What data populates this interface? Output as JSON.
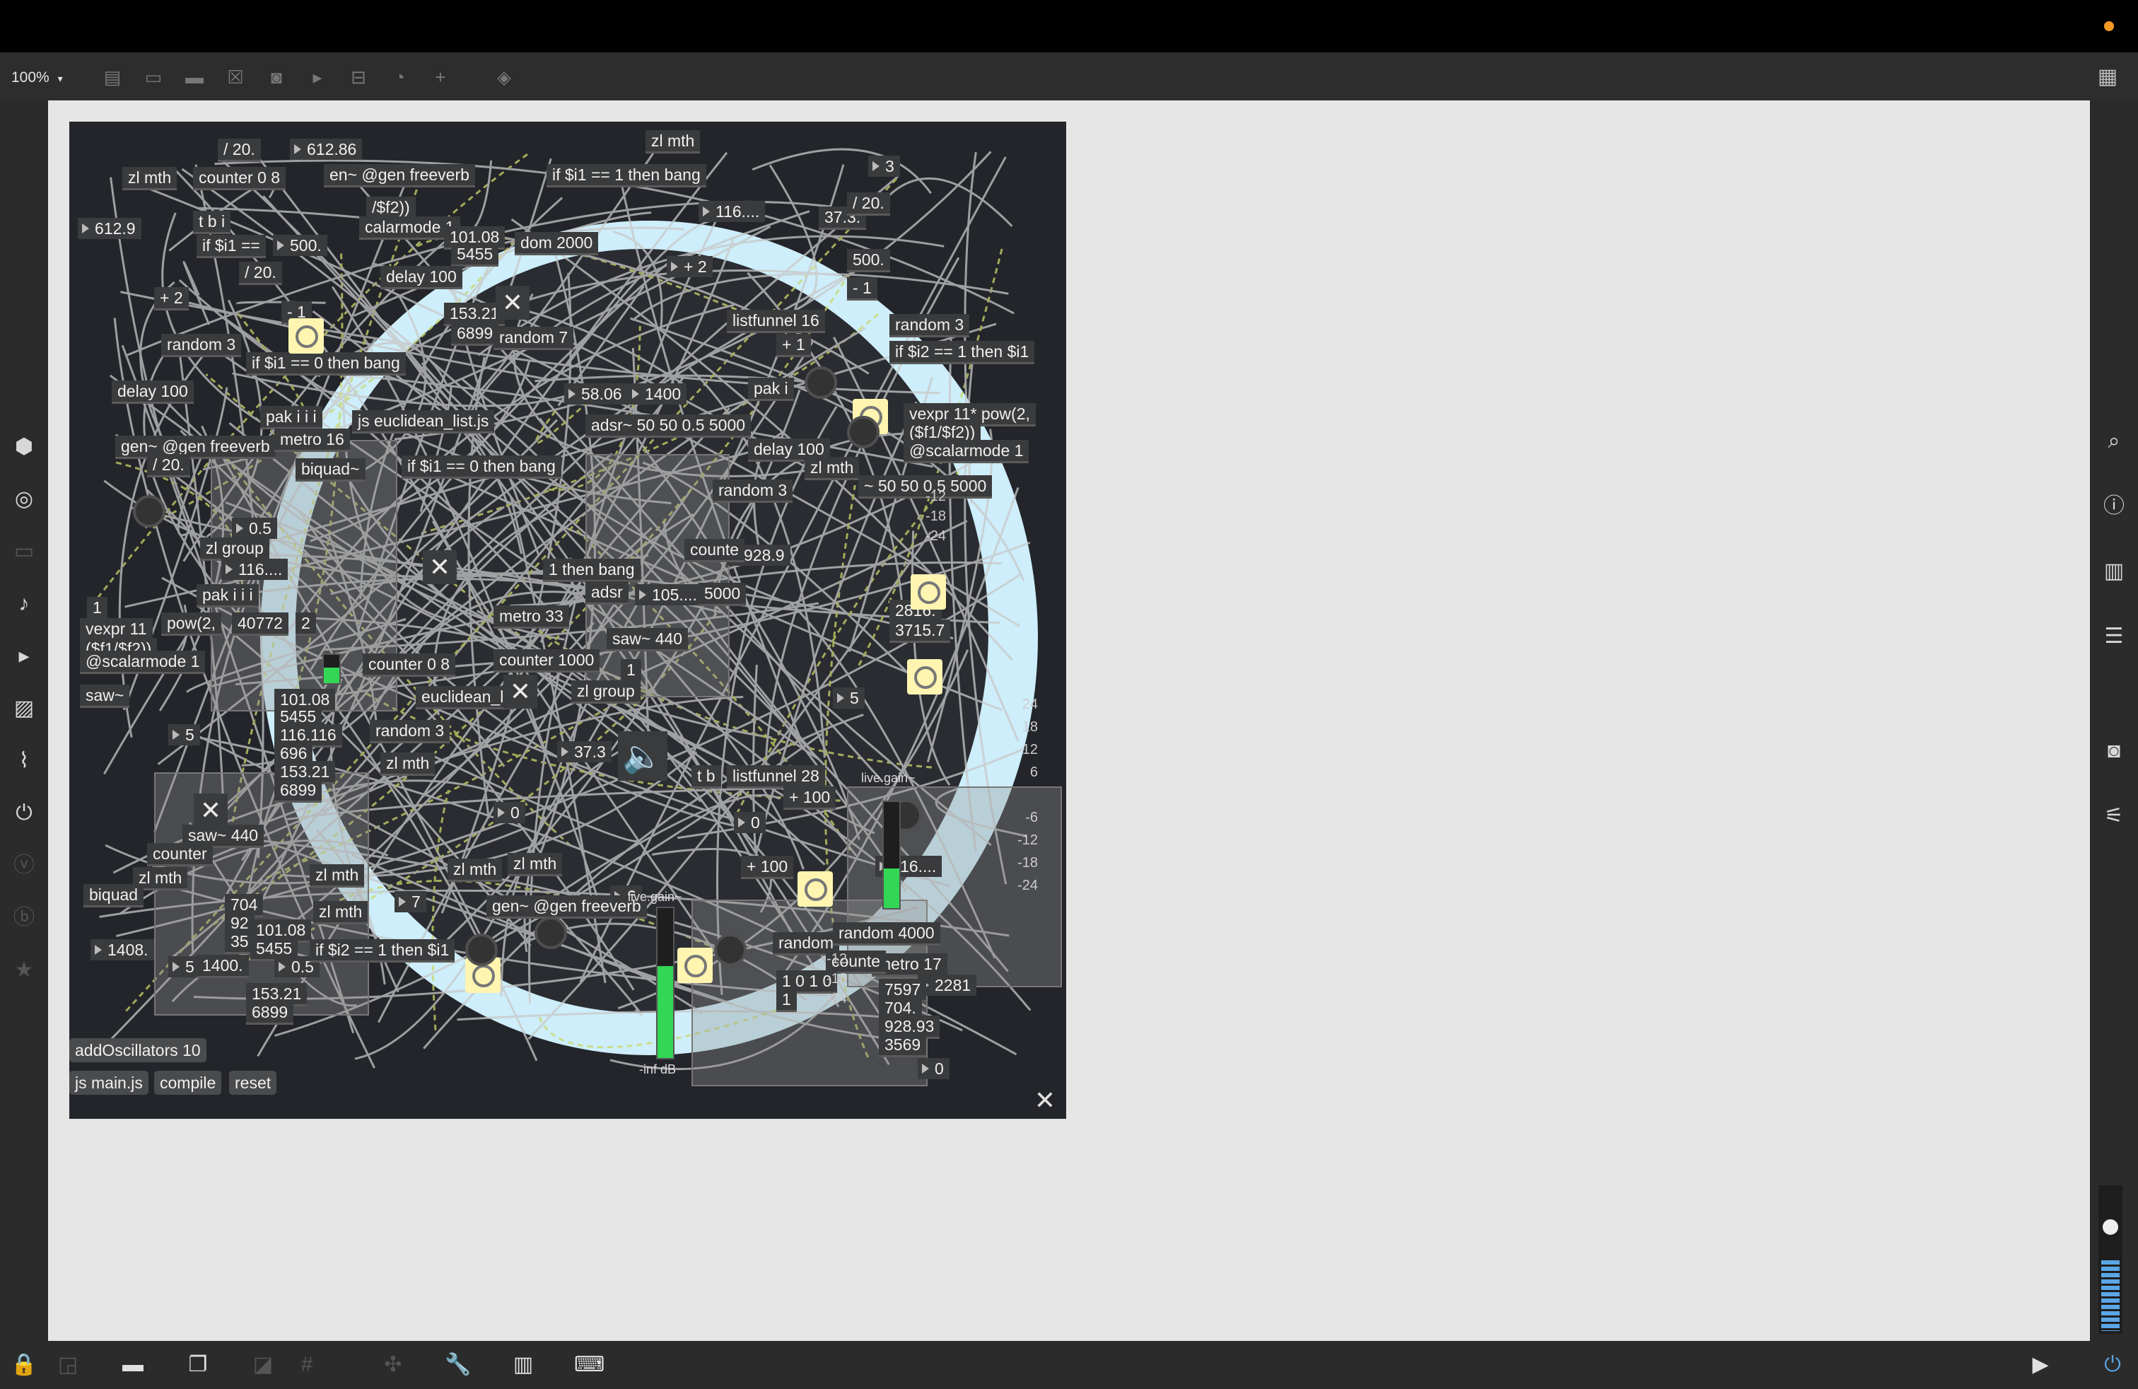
{
  "toolbar": {
    "zoom_label": "100%",
    "zoom_caret": "▾",
    "icons": [
      "presentation-icon",
      "object-icon",
      "message-icon",
      "toggle-box-icon",
      "button-box-icon",
      "number-box-icon",
      "slider-box-icon",
      "dial-icon",
      "add-icon",
      "paint-bucket-icon"
    ],
    "grid_icon": "▦"
  },
  "left_sidebar": {
    "icons": [
      "package-icon",
      "target-icon",
      "device-icon",
      "music-note-icon",
      "clip-icon",
      "image-icon",
      "attach-icon",
      "plug-icon",
      "vimeo-icon",
      "history-icon",
      "favorite-icon"
    ]
  },
  "right_sidebar": {
    "icons": [
      "search-icon",
      "info-icon",
      "split-view-icon",
      "list-icon",
      "snapshot-icon",
      "mixer-icon"
    ]
  },
  "patch": {
    "objects": [
      {
        "t": "/ 20."
      },
      {
        "t": "612.86"
      },
      {
        "t": "zl mth"
      },
      {
        "t": "counter 0 8"
      },
      {
        "t": "en~ @gen freeverb"
      },
      {
        "t": "if $i1 == 1 then bang"
      },
      {
        "t": "zl mth"
      },
      {
        "t": "3"
      },
      {
        "t": "612.9"
      },
      {
        "t": "t b i"
      },
      {
        "t": "/$f2))"
      },
      {
        "t": "calarmode 1"
      },
      {
        "t": "116...."
      },
      {
        "t": "37.3."
      },
      {
        "t": "/ 20."
      },
      {
        "t": "if $i1 =="
      },
      {
        "t": "500."
      },
      {
        "t": "101.08"
      },
      {
        "t": "5455"
      },
      {
        "t": "dom 2000"
      },
      {
        "t": "+ 2"
      },
      {
        "t": "500."
      },
      {
        "t": "/ 20."
      },
      {
        "t": "delay 100"
      },
      {
        "t": "- 1"
      },
      {
        "t": "+ 2"
      },
      {
        "t": "- 1"
      },
      {
        "t": "153.21"
      },
      {
        "t": "6899"
      },
      {
        "t": "listfunnel 16"
      },
      {
        "t": "random 3"
      },
      {
        "t": "random 3"
      },
      {
        "t": "random 7"
      },
      {
        "t": "+ 1"
      },
      {
        "t": "if $i2 == 1 then $i1"
      },
      {
        "t": "if $i1 == 0 then bang"
      },
      {
        "t": "delay 100"
      },
      {
        "t": "58.06"
      },
      {
        "t": "1400"
      },
      {
        "t": "pak i"
      },
      {
        "t": "vexpr 11* pow(2,"
      },
      {
        "t": "($f1/$f2))"
      },
      {
        "t": "@scalarmode 1"
      },
      {
        "t": "pak i i i"
      },
      {
        "t": "js euclidean_list.js"
      },
      {
        "t": "adsr~ 50 50 0.5 5000"
      },
      {
        "t": "gen~ @gen freeverb"
      },
      {
        "t": "metro 16"
      },
      {
        "t": "delay 100"
      },
      {
        "t": "zl mth"
      },
      {
        "t": "/ 20."
      },
      {
        "t": "biquad~"
      },
      {
        "t": "if $i1 == 0 then bang"
      },
      {
        "t": "random 3"
      },
      {
        "t": "~ 50 50 0.5 5000"
      },
      {
        "t": "0.5"
      },
      {
        "t": "zl group"
      },
      {
        "t": "116...."
      },
      {
        "t": "928.9"
      },
      {
        "t": "counte"
      },
      {
        "t": "pak i i i"
      },
      {
        "t": "1 then bang"
      },
      {
        "t": "adsr"
      },
      {
        "t": "105...."
      },
      {
        "t": "5000"
      },
      {
        "t": "1"
      },
      {
        "t": "pow(2,"
      },
      {
        "t": "40772"
      },
      {
        "t": "2"
      },
      {
        "t": "metro 33"
      },
      {
        "t": "2816."
      },
      {
        "t": "3715.7"
      },
      {
        "t": "vexpr 11"
      },
      {
        "t": "($f1/$f2))"
      },
      {
        "t": "@scalarmode 1"
      },
      {
        "t": "saw~ 440"
      },
      {
        "t": "counter 0 8"
      },
      {
        "t": "counter 1000"
      },
      {
        "t": "1"
      },
      {
        "t": "saw~"
      },
      {
        "t": "101.08"
      },
      {
        "t": "5455"
      },
      {
        "t": "116.116"
      },
      {
        "t": "696"
      },
      {
        "t": "153.21"
      },
      {
        "t": "6899"
      },
      {
        "t": "euclidean_li"
      },
      {
        "t": "zl group"
      },
      {
        "t": "5"
      },
      {
        "t": "5"
      },
      {
        "t": "random 3"
      },
      {
        "t": "zl mth"
      },
      {
        "t": "37.3"
      },
      {
        "t": "t b"
      },
      {
        "t": "listfunnel 28"
      },
      {
        "t": "+ 100"
      },
      {
        "t": "saw~ 440"
      },
      {
        "t": "0"
      },
      {
        "t": "0"
      },
      {
        "t": "counter"
      },
      {
        "t": "zl mth"
      },
      {
        "t": "zl mth"
      },
      {
        "t": "zl mth"
      },
      {
        "t": "zl mth"
      },
      {
        "t": "+ 100"
      },
      {
        "t": "116...."
      },
      {
        "t": "biquad"
      },
      {
        "t": "704"
      },
      {
        "t": "92"
      },
      {
        "t": "35"
      },
      {
        "t": "zl mth"
      },
      {
        "t": "7"
      },
      {
        "t": "6"
      },
      {
        "t": "gen~ @gen freeverb"
      },
      {
        "t": "random"
      },
      {
        "t": "random 4000"
      },
      {
        "t": "1408."
      },
      {
        "t": "5"
      },
      {
        "t": "1400."
      },
      {
        "t": "101.08"
      },
      {
        "t": "5455"
      },
      {
        "t": "0.5"
      },
      {
        "t": "if $i2 == 1 then $i1"
      },
      {
        "t": "metro 17"
      },
      {
        "t": "2281"
      },
      {
        "t": "counte"
      },
      {
        "t": "7597"
      },
      {
        "t": "704."
      },
      {
        "t": "928.93"
      },
      {
        "t": "3569"
      },
      {
        "t": "153.21"
      },
      {
        "t": "6899"
      },
      {
        "t": "1 0 1 0"
      },
      {
        "t": "1"
      },
      {
        "t": "0"
      }
    ],
    "messages": {
      "add_osc": "addOscillators 10",
      "js_main": "js main.js",
      "compile": "compile",
      "reset": "reset"
    },
    "live_gain_label": "live.gain~",
    "db_label": "-inf dB",
    "scale_right": [
      "24",
      "18",
      "12",
      "6",
      "",
      "-6",
      "-12",
      "-18",
      "-24"
    ],
    "scale_small": [
      "-12",
      "-18",
      "-24"
    ],
    "speaker_icon": "speaker-icon",
    "close_label": "✕"
  },
  "bottom_bar": {
    "icons": [
      "lock-icon",
      "edit-icon",
      "presentation-icon",
      "windows-icon",
      "mute-icon",
      "grid-icon",
      "pointer-icon",
      "wrench-icon",
      "piano-icon",
      "keyboard-icon",
      "play-icon",
      "power-icon"
    ]
  },
  "colors": {
    "titlebar": "#000000",
    "toolbar": "#2d2d2d",
    "canvas": "#e6e6e6",
    "patch_bg": "#23252a",
    "bang": "#fff5b0",
    "meter": "#33d655",
    "sphere": "#cdeefa",
    "accent_orange": "#f59a23",
    "volume_blue": "#5aa6e6"
  }
}
